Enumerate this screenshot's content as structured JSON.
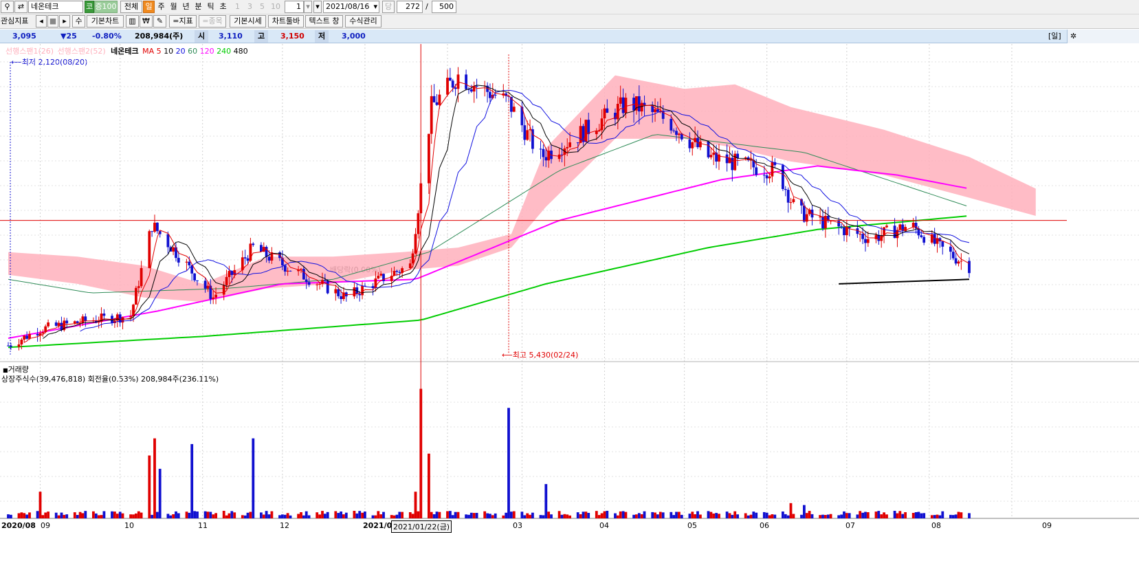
{
  "toolbar": {
    "stock_name": "네온테크",
    "market_badge": "코",
    "credit_badge": "증100",
    "period_all": "전체",
    "periods": [
      "일",
      "주",
      "월",
      "년",
      "분",
      "틱",
      "초"
    ],
    "selected_period": "일",
    "minute_buttons": [
      "1",
      "3",
      "5",
      "10"
    ],
    "unit_value": "1",
    "date_value": "2021/08/16",
    "date_side": "당",
    "count_value": "272",
    "count_sep": "/",
    "count_total": "500",
    "row2": {
      "indicator_label": "관심지표",
      "nav_prev": "◂",
      "nav_stop": "■",
      "nav_next": "▸",
      "su": "수",
      "basic_chart": "기본차트",
      "indicator": "=지표",
      "item": "=종목",
      "basic_quote": "기본시세",
      "chart_toolbar": "차트툴바",
      "text_window": "텍스트 창",
      "formula_manage": "수식관리"
    }
  },
  "quote": {
    "price": "3,095",
    "change": "▼25",
    "change_pct": "-0.80%",
    "volume": "208,984(주)",
    "open_label": "시",
    "open": "3,110",
    "high_label": "고",
    "high": "3,150",
    "low_label": "저",
    "low": "3,000",
    "period_tag": "[일]"
  },
  "legend": {
    "span1": "선행스팬1(26)",
    "span2": "선행스팬2(52)",
    "stock": "네온테크",
    "ma_label": "MA",
    "ma_periods": [
      "5",
      "10",
      "20",
      "60",
      "120",
      "240",
      "480"
    ]
  },
  "annotations": {
    "low": "최저 2,120(08/20)",
    "high": "최고 5,430(02/24)",
    "dividend": "배당락(0.00%)"
  },
  "volume_panel": {
    "title": "거래량",
    "info": "상장주식수(39,476,818) 회전율(0.53%) 208,984주(236.11%)"
  },
  "date_axis": {
    "first": "2020/08",
    "months": [
      "09",
      "10",
      "11",
      "12",
      "03",
      "04",
      "05",
      "06",
      "07",
      "08",
      "09"
    ],
    "year_label": "2021/0",
    "cursor_date": "2021/01/22(금)"
  },
  "colors": {
    "up": "#e00000",
    "down": "#1010d0",
    "ma5": "#e00000",
    "ma10": "#000000",
    "ma20": "#1010e0",
    "ma60": "#2e8b57",
    "ma120": "#ff00ff",
    "ma240": "#00cc00",
    "cloud": "#ffb0bc",
    "quote_bar": "#d9e8f7"
  },
  "chart_data": {
    "type": "candlestick",
    "x_range": [
      "2020-08-20",
      "2021-08-16"
    ],
    "y_range": [
      2050,
      5500
    ],
    "anchors": [
      [
        "2020-08-20",
        2220
      ],
      [
        "2020-09-01",
        2400
      ],
      [
        "2020-09-20",
        2500
      ],
      [
        "2020-10-05",
        2550
      ],
      [
        "2020-10-13",
        3550
      ],
      [
        "2020-10-22",
        3250
      ],
      [
        "2020-11-05",
        2750
      ],
      [
        "2020-11-20",
        3300
      ],
      [
        "2020-12-05",
        3050
      ],
      [
        "2020-12-25",
        2750
      ],
      [
        "2021-01-10",
        3000
      ],
      [
        "2021-01-18",
        3100
      ],
      [
        "2021-01-26",
        4850
      ],
      [
        "2021-02-05",
        5200
      ],
      [
        "2021-02-24",
        4900
      ],
      [
        "2021-03-02",
        4600
      ],
      [
        "2021-03-08",
        4300
      ],
      [
        "2021-03-20",
        4500
      ],
      [
        "2021-04-10",
        4900
      ],
      [
        "2021-04-25",
        4700
      ],
      [
        "2021-05-10",
        4300
      ],
      [
        "2021-05-25",
        4200
      ],
      [
        "2021-06-05",
        4150
      ],
      [
        "2021-06-12",
        3700
      ],
      [
        "2021-06-25",
        3550
      ],
      [
        "2021-07-10",
        3400
      ],
      [
        "2021-07-25",
        3550
      ],
      [
        "2021-08-05",
        3300
      ],
      [
        "2021-08-16",
        3095
      ]
    ],
    "cloud_band": [
      [
        "2020-08-20",
        3000,
        3250
      ],
      [
        "2020-09-15",
        2900,
        3200
      ],
      [
        "2020-10-10",
        2750,
        3100
      ],
      [
        "2020-11-01",
        2700,
        2900
      ],
      [
        "2020-11-25",
        2850,
        3200
      ],
      [
        "2020-12-20",
        2900,
        3200
      ],
      [
        "2021-01-15",
        3050,
        3250
      ],
      [
        "2021-02-05",
        3100,
        3300
      ],
      [
        "2021-02-25",
        3300,
        3450
      ],
      [
        "2021-03-10",
        3750,
        4400
      ],
      [
        "2021-04-05",
        4500,
        5200
      ],
      [
        "2021-05-01",
        4500,
        5050
      ],
      [
        "2021-05-20",
        4400,
        5100
      ],
      [
        "2021-06-10",
        4250,
        4850
      ],
      [
        "2021-07-15",
        4100,
        4600
      ],
      [
        "2021-08-16",
        3850,
        4300
      ],
      [
        "2021-09-10",
        3650,
        3950
      ]
    ],
    "ma120": [
      [
        "2020-08-20",
        2300
      ],
      [
        "2020-10-15",
        2600
      ],
      [
        "2020-12-01",
        2900
      ],
      [
        "2021-01-20",
        2950
      ],
      [
        "2021-03-15",
        3600
      ],
      [
        "2021-05-15",
        4050
      ],
      [
        "2021-06-20",
        4200
      ],
      [
        "2021-07-20",
        4100
      ],
      [
        "2021-08-16",
        3950
      ]
    ],
    "ma240": [
      [
        "2020-08-20",
        2200
      ],
      [
        "2020-11-01",
        2320
      ],
      [
        "2021-01-22",
        2500
      ],
      [
        "2021-03-10",
        2900
      ],
      [
        "2021-05-10",
        3300
      ],
      [
        "2021-06-20",
        3500
      ],
      [
        "2021-08-16",
        3650
      ]
    ],
    "ma60": [
      [
        "2020-08-20",
        2950
      ],
      [
        "2020-09-20",
        2800
      ],
      [
        "2020-11-10",
        2850
      ],
      [
        "2020-12-20",
        2950
      ],
      [
        "2021-01-25",
        3250
      ],
      [
        "2021-03-15",
        4150
      ],
      [
        "2021-04-20",
        4550
      ],
      [
        "2021-06-15",
        4350
      ],
      [
        "2021-08-16",
        3750
      ]
    ],
    "trendline": [
      [
        "2021-06-28",
        2900
      ],
      [
        "2021-08-16",
        2950
      ]
    ],
    "high_marker": [
      "2021-02-24",
      5430
    ],
    "low_marker": [
      "2020-08-20",
      2120
    ],
    "cursor_price": 3600,
    "volume_spikes": [
      [
        "2020-09-01",
        1400000
      ],
      [
        "2020-10-12",
        3300000
      ],
      [
        "2020-10-14",
        4200000
      ],
      [
        "2020-10-16",
        2600000
      ],
      [
        "2020-10-28",
        3900000
      ],
      [
        "2020-11-20",
        4200000
      ],
      [
        "2021-01-20",
        1400000
      ],
      [
        "2021-01-22",
        6800000
      ],
      [
        "2021-01-25",
        3400000
      ],
      [
        "2021-02-24",
        5800000
      ],
      [
        "2021-03-10",
        1800000
      ],
      [
        "2021-06-10",
        800000
      ],
      [
        "2021-06-15",
        700000
      ],
      [
        "2021-07-10",
        400000
      ]
    ],
    "volume_max": 7000000
  }
}
